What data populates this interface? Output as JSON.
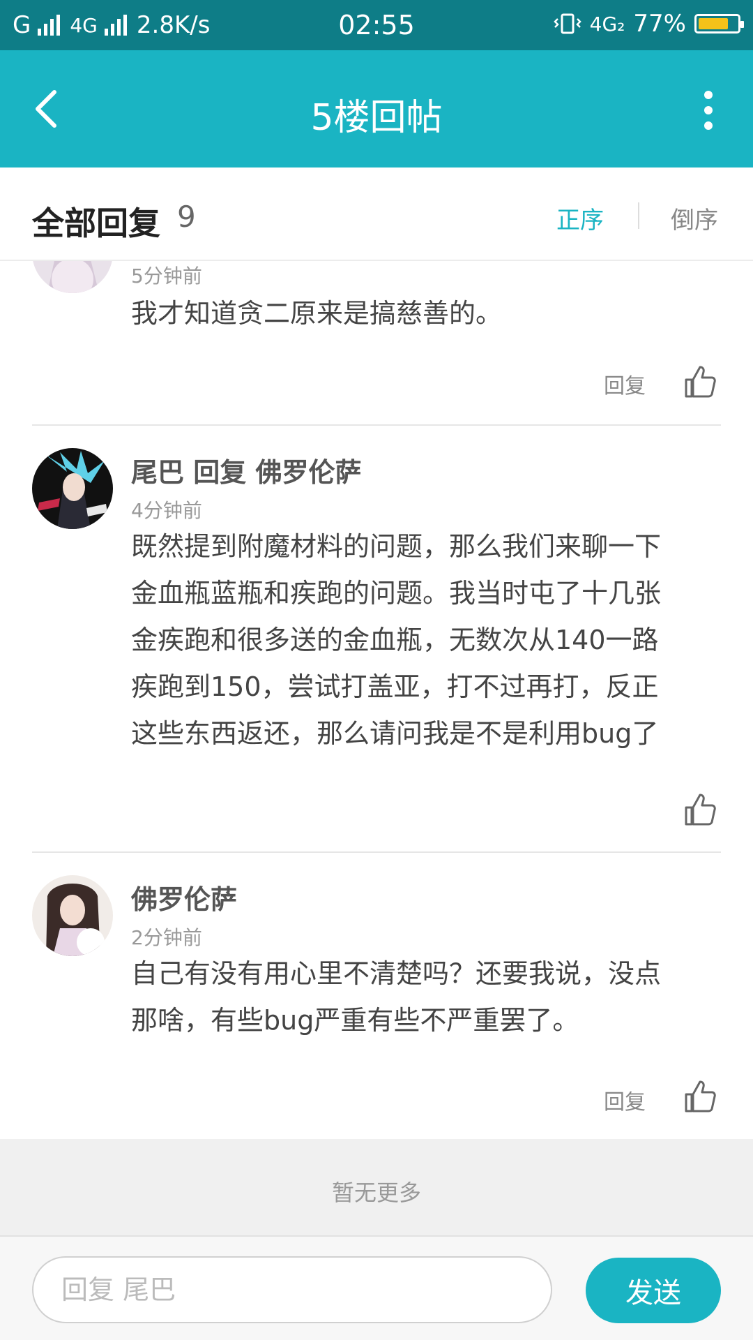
{
  "status_bar": {
    "carrier": "G",
    "network": "4G",
    "speed": "2.8K/s",
    "time": "02:55",
    "network_right": "4G₂",
    "battery_text": "77%",
    "battery_level": 0.77
  },
  "title_bar": {
    "title": "5楼回帖",
    "back_icon": "chevron-left-icon",
    "more_icon": "vertical-dots-icon"
  },
  "header": {
    "title": "全部回复",
    "count": "9",
    "sort_asc": "正序",
    "sort_desc": "倒序",
    "accent_color": "#1ab4c3"
  },
  "replies": [
    {
      "username": "",
      "time": "5分钟前",
      "lines": [
        "我才知道贪二原来是搞慈善的。"
      ],
      "reply_label": "回复"
    },
    {
      "username": "尾巴 回复 佛罗伦萨",
      "time": "4分钟前",
      "lines": [
        "既然提到附魔材料的问题，那么我们来聊一下",
        "金血瓶蓝瓶和疾跑的问题。我当时屯了十几张",
        "金疾跑和很多送的金血瓶，无数次从140一路",
        "疾跑到150，尝试打盖亚，打不过再打，反正",
        "这些东西返还，那么请问我是不是利用bug了"
      ],
      "reply_label": ""
    },
    {
      "username": "佛罗伦萨",
      "time": "2分钟前",
      "lines": [
        "自己有没有用心里不清楚吗？还要我说，没点",
        "那啥，有些bug严重有些不严重罢了。"
      ],
      "reply_label": "回复"
    }
  ],
  "footer": {
    "no_more": "暂无更多",
    "input_placeholder": "回复 尾巴",
    "send_label": "发送"
  }
}
